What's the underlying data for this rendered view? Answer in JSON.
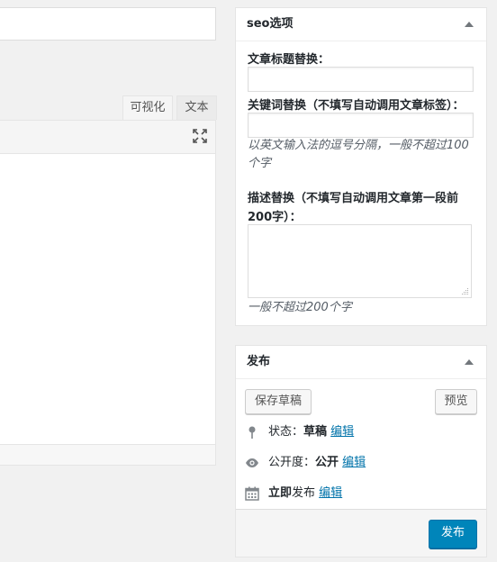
{
  "editor": {
    "tab_visual": "可视化",
    "tab_text": "文本"
  },
  "seo_box": {
    "title": "seo选项",
    "title_replace_label": "文章标题替换：",
    "keywords_label": "关键词替换（不填写自动调用文章标签）：",
    "keywords_hint": "以英文输入法的逗号分隔，一般不超过100个字",
    "description_label": "描述替换（不填写自动调用文章第一段前200字）：",
    "description_hint": "一般不超过200个字"
  },
  "publish_box": {
    "title": "发布",
    "save_draft": "保存草稿",
    "preview": "预览",
    "status_label": "状态：",
    "status_value": "草稿",
    "visibility_label": "公开度：",
    "visibility_value": "公开",
    "schedule_label": "立即",
    "schedule_suffix": "发布",
    "edit_link": "编辑",
    "publish_button": "发布",
    "accent_color": "#0085ba",
    "link_color": "#0073aa"
  }
}
